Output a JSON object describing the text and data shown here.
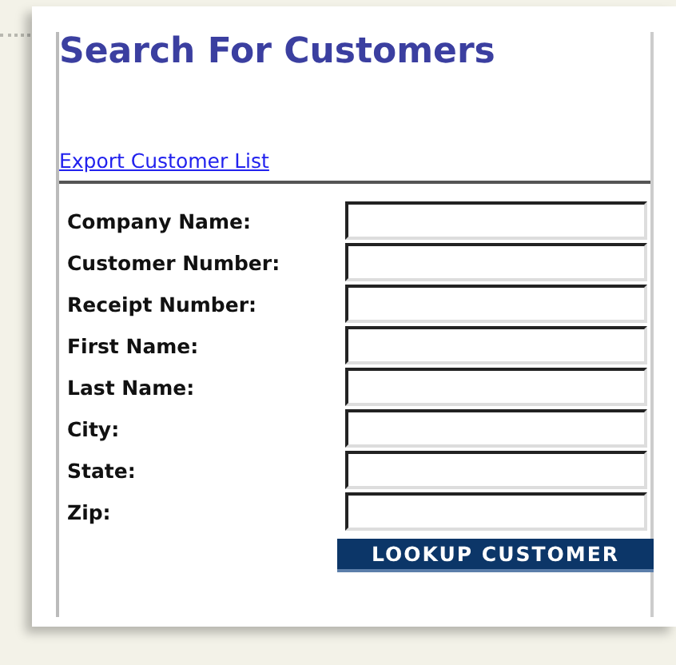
{
  "title": "Search For Customers",
  "export_link": "Export Customer List",
  "fields": [
    {
      "label": "Company Name:"
    },
    {
      "label": "Customer Number:"
    },
    {
      "label": "Receipt Number:"
    },
    {
      "label": "First Name:"
    },
    {
      "label": "Last Name:"
    },
    {
      "label": "City:"
    },
    {
      "label": "State:"
    },
    {
      "label": "Zip:"
    }
  ],
  "button": "LOOKUP CUSTOMER"
}
